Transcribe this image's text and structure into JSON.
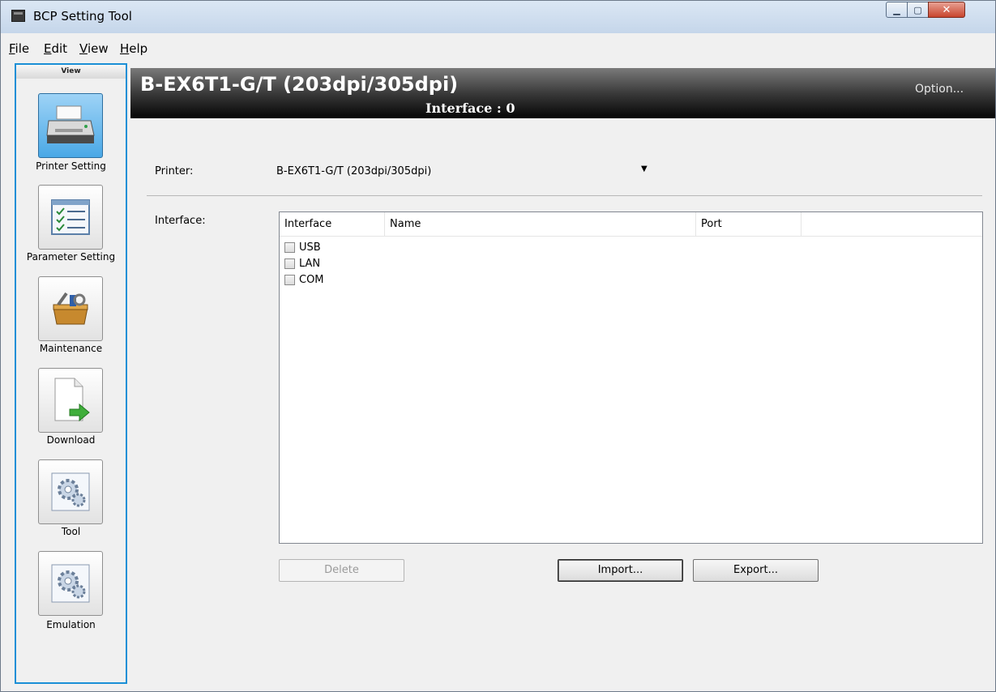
{
  "window": {
    "title": "BCP Setting Tool"
  },
  "menu": [
    {
      "label": "File",
      "key": "F"
    },
    {
      "label": "Edit",
      "key": "E"
    },
    {
      "label": "View",
      "key": "V"
    },
    {
      "label": "Help",
      "key": "H"
    }
  ],
  "nav": {
    "header": "View",
    "items": [
      {
        "label": "Printer Setting",
        "icon": "printer-icon",
        "active": true
      },
      {
        "label": "Parameter Setting",
        "icon": "checklist-icon",
        "active": false
      },
      {
        "label": "Maintenance",
        "icon": "toolbox-icon",
        "active": false
      },
      {
        "label": "Download",
        "icon": "download-document-icon",
        "active": false
      },
      {
        "label": "Tool",
        "icon": "gear-icon",
        "active": false
      },
      {
        "label": "Emulation",
        "icon": "gear-icon",
        "active": false
      }
    ]
  },
  "banner": {
    "model": "B-EX6T1-G/T (203dpi/305dpi)",
    "interface": "Interface : 0",
    "option": "Option..."
  },
  "printer": {
    "label": "Printer:",
    "selected": "B-EX6T1-G/T (203dpi/305dpi)"
  },
  "interface": {
    "label": "Interface:",
    "columns": [
      "Interface",
      "Name",
      "Port"
    ],
    "rows": [
      {
        "label": "USB",
        "checked": false
      },
      {
        "label": "LAN",
        "checked": false
      },
      {
        "label": "COM",
        "checked": false
      }
    ]
  },
  "buttons": {
    "delete": "Delete",
    "import": "Import...",
    "export": "Export..."
  },
  "colors": {
    "nav_border": "#1a8fd6",
    "active_nav": "#4aa8e6",
    "banner": "#000000"
  }
}
